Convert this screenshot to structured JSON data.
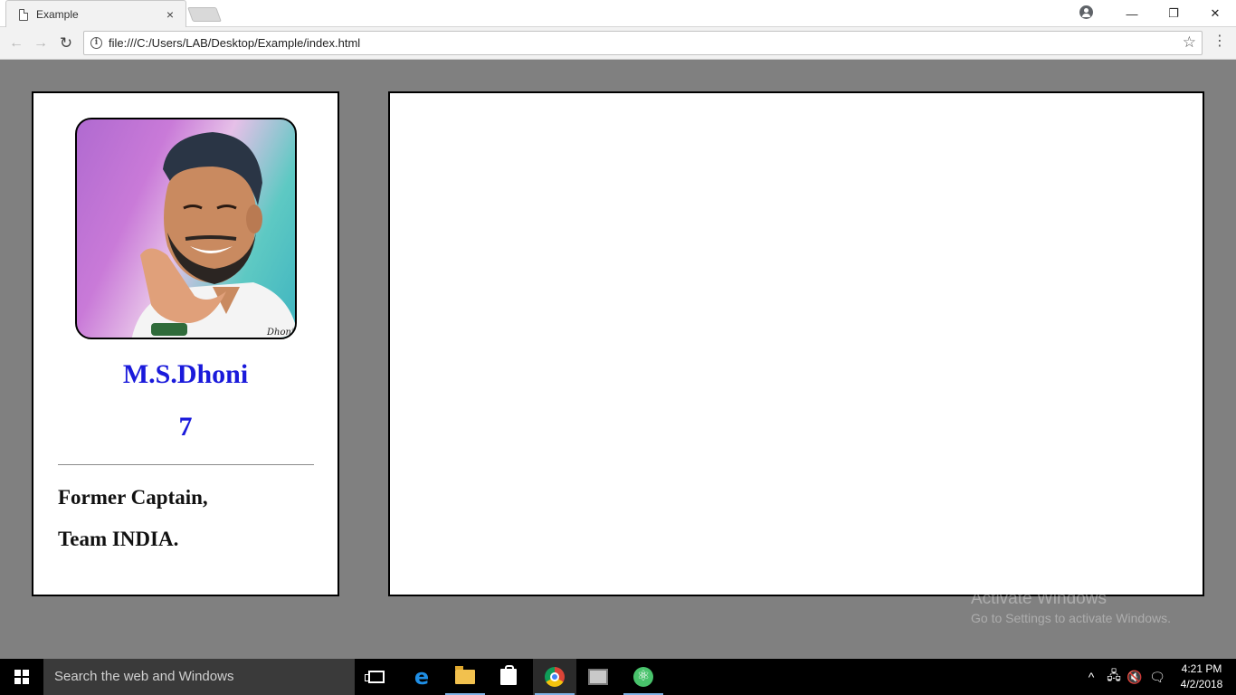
{
  "browser": {
    "tab_title": "Example",
    "tab_close": "×",
    "url": "file:///C:/Users/LAB/Desktop/Example/index.html",
    "window_controls": {
      "minimize": "—",
      "restore": "❐",
      "close": "✕"
    },
    "icons": {
      "back": "back-arrow-icon",
      "forward": "forward-arrow-icon",
      "reload": "reload-icon",
      "info": "info-icon",
      "star": "bookmark-star-icon",
      "menu": "menu-icon",
      "profile": "profile-icon"
    }
  },
  "card": {
    "name": "M.S.Dhoni",
    "number": "7",
    "description_line1": "Former Captain,",
    "description_line2": "Team INDIA."
  },
  "watermark": {
    "line1": "Activate Windows",
    "line2": "Go to Settings to activate Windows."
  },
  "taskbar": {
    "search_placeholder": "Search the web and Windows",
    "time": "4:21 PM",
    "date": "4/2/2018",
    "apps": [
      "task-view",
      "edge",
      "file-explorer",
      "store",
      "chrome",
      "network-app",
      "atom"
    ]
  },
  "colors": {
    "page_background": "#808080",
    "name_color": "#1a1adb",
    "text_color": "#111111",
    "taskbar": "#000000"
  }
}
